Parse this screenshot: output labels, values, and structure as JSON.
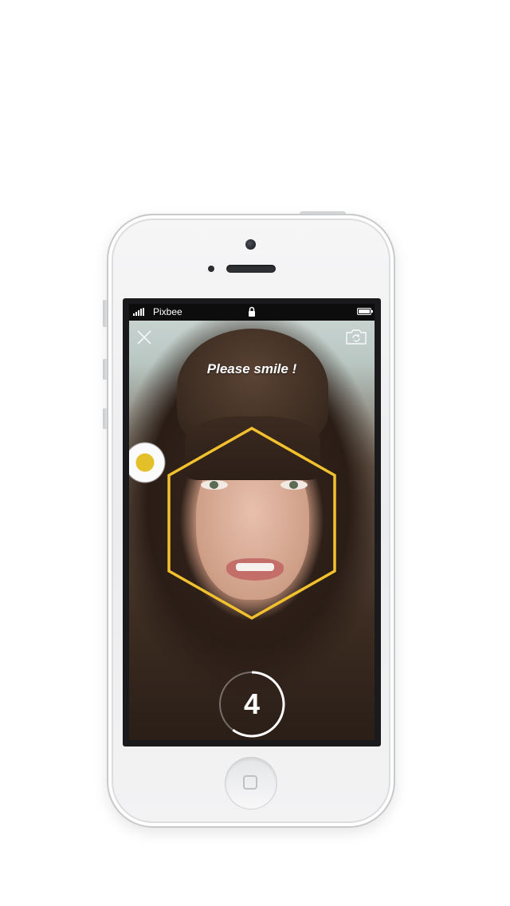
{
  "statusbar": {
    "carrier": "Pixbee",
    "signal_icon": "signal-bars-icon",
    "lock_icon": "lock-icon",
    "battery_icon": "battery-icon"
  },
  "camera": {
    "prompt": "Please smile !",
    "countdown": "4",
    "countdown_progress": 0.6,
    "close_icon": "close-icon",
    "switch_camera_icon": "switch-camera-icon",
    "face_frame_color": "#f2c12e"
  },
  "colors": {
    "accent": "#f2c12e",
    "statusbar": "#0d0d0d"
  }
}
